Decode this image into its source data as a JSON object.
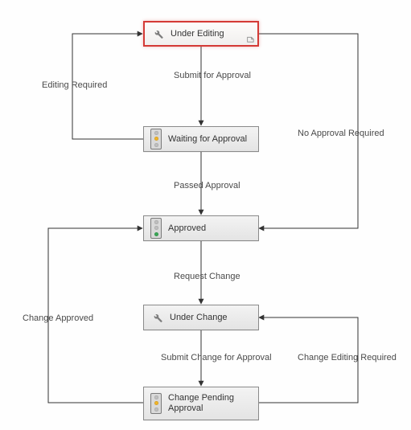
{
  "nodes": {
    "under_editing": {
      "label": "Under Editing"
    },
    "waiting": {
      "label": "Waiting for Approval"
    },
    "approved": {
      "label": "Approved"
    },
    "under_change": {
      "label": "Under Change"
    },
    "change_pending": {
      "label": "Change Pending Approval"
    }
  },
  "edges": {
    "submit_for_approval": "Submit for Approval",
    "editing_required": "Editing Required",
    "no_approval_required": "No Approval Required",
    "passed_approval": "Passed Approval",
    "request_change": "Request Change",
    "submit_change_for_approval": "Submit Change for Approval",
    "change_approved": "Change Approved",
    "change_editing_required": "Change Editing Required"
  },
  "chart_data": {
    "type": "state-diagram",
    "states": [
      {
        "id": "under_editing",
        "label": "Under Editing",
        "icon": "wrench",
        "selected": true
      },
      {
        "id": "waiting",
        "label": "Waiting for Approval",
        "icon": "traffic-amber",
        "selected": false
      },
      {
        "id": "approved",
        "label": "Approved",
        "icon": "traffic-green",
        "selected": false
      },
      {
        "id": "under_change",
        "label": "Under Change",
        "icon": "wrench",
        "selected": false
      },
      {
        "id": "change_pending",
        "label": "Change Pending Approval",
        "icon": "traffic-amber",
        "selected": false
      }
    ],
    "transitions": [
      {
        "from": "under_editing",
        "to": "waiting",
        "label": "Submit for Approval"
      },
      {
        "from": "waiting",
        "to": "under_editing",
        "label": "Editing Required"
      },
      {
        "from": "under_editing",
        "to": "approved",
        "label": "No Approval Required"
      },
      {
        "from": "waiting",
        "to": "approved",
        "label": "Passed Approval"
      },
      {
        "from": "approved",
        "to": "under_change",
        "label": "Request Change"
      },
      {
        "from": "under_change",
        "to": "change_pending",
        "label": "Submit Change for Approval"
      },
      {
        "from": "change_pending",
        "to": "approved",
        "label": "Change Approved"
      },
      {
        "from": "change_pending",
        "to": "under_change",
        "label": "Change Editing Required"
      }
    ]
  }
}
